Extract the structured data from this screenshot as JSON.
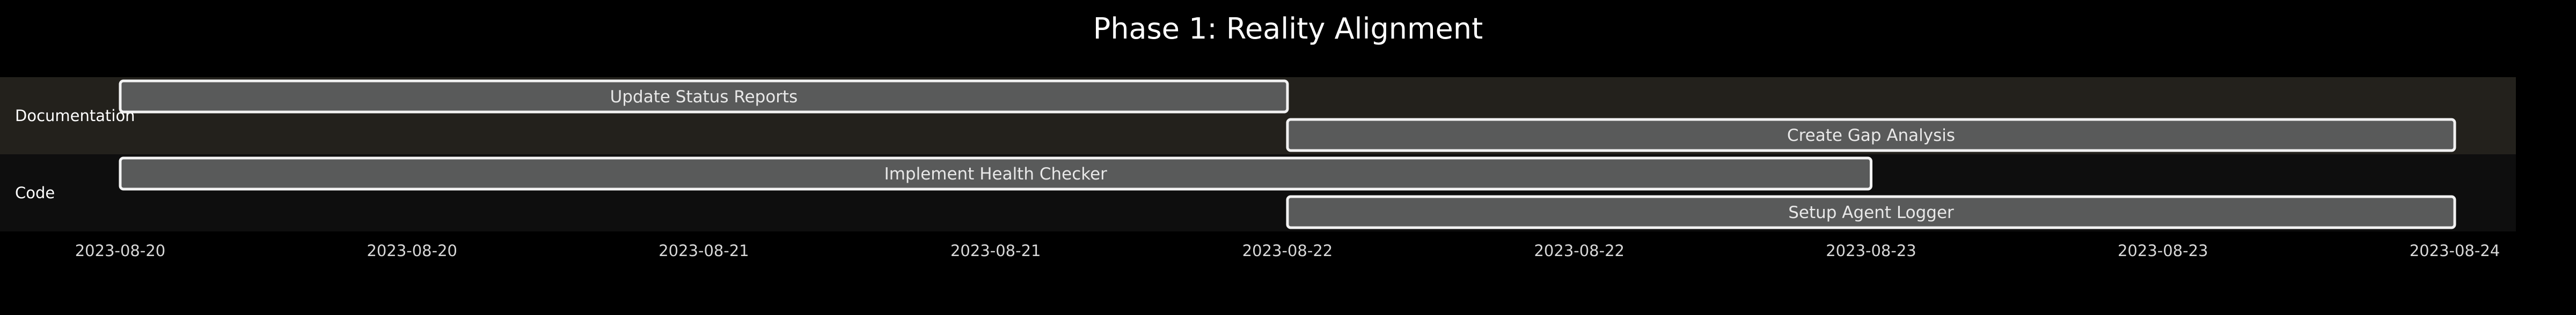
{
  "chart_data": {
    "type": "gantt",
    "title": "Phase 1: Reality Alignment",
    "x_range": [
      "2023-08-20T00:00",
      "2023-08-24T00:00"
    ],
    "x_ticks": [
      {
        "at": "2023-08-20T00:00",
        "label": "2023-08-20"
      },
      {
        "at": "2023-08-20T12:00",
        "label": "2023-08-20"
      },
      {
        "at": "2023-08-21T00:00",
        "label": "2023-08-21"
      },
      {
        "at": "2023-08-21T12:00",
        "label": "2023-08-21"
      },
      {
        "at": "2023-08-22T00:00",
        "label": "2023-08-22"
      },
      {
        "at": "2023-08-22T12:00",
        "label": "2023-08-22"
      },
      {
        "at": "2023-08-23T00:00",
        "label": "2023-08-23"
      },
      {
        "at": "2023-08-23T12:00",
        "label": "2023-08-23"
      },
      {
        "at": "2023-08-24T00:00",
        "label": "2023-08-24"
      }
    ],
    "sections": [
      {
        "name": "Documentation",
        "band_color": "#23211c",
        "tasks": [
          {
            "name": "Update Status Reports",
            "start": "2023-08-20T00:00",
            "end": "2023-08-22T00:00"
          },
          {
            "name": "Create Gap Analysis",
            "start": "2023-08-22T00:00",
            "end": "2023-08-24T00:00"
          }
        ]
      },
      {
        "name": "Code",
        "band_color": "#0e0e0e",
        "tasks": [
          {
            "name": "Implement Health Checker",
            "start": "2023-08-20T00:00",
            "end": "2023-08-23T00:00"
          },
          {
            "name": "Setup Agent Logger",
            "start": "2023-08-22T00:00",
            "end": "2023-08-24T00:00"
          }
        ]
      }
    ],
    "colors": {
      "background": "#000000",
      "bar_fill": "#595a5a",
      "bar_stroke": "#f2f2f2",
      "text": "#ffffff"
    }
  }
}
